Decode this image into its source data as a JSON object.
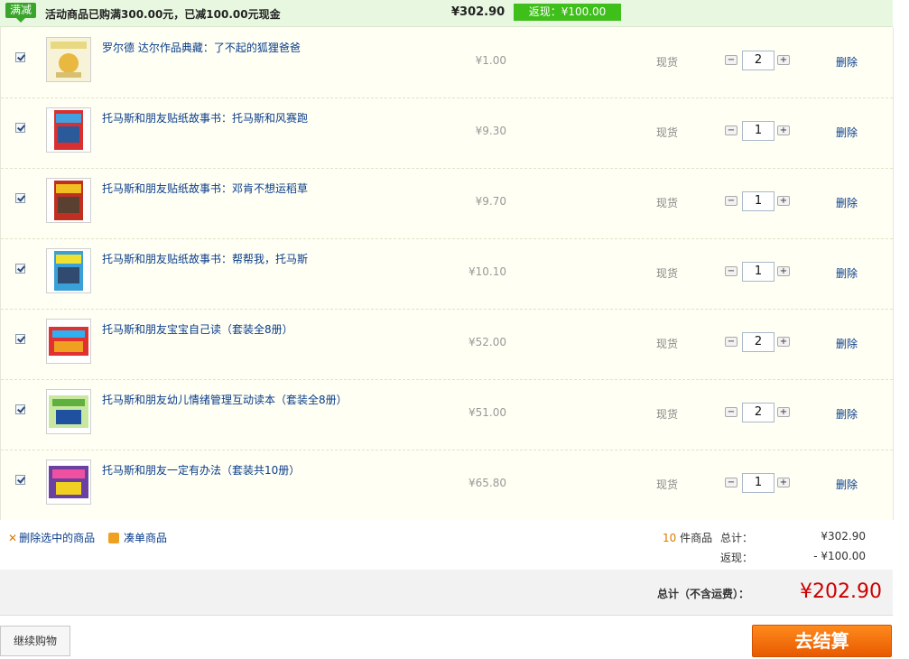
{
  "promo": {
    "tag": "满减",
    "text": "活动商品已购满300.00元，已减100.00元现金",
    "total": "¥302.90",
    "cashback": "返现：¥100.00"
  },
  "items": [
    {
      "title": "罗尔德 达尔作品典藏：了不起的狐狸爸爸",
      "price": "¥1.00",
      "stock": "现货",
      "qty": "2",
      "delete": "删除"
    },
    {
      "title": "托马斯和朋友贴纸故事书：托马斯和风赛跑",
      "price": "¥9.30",
      "stock": "现货",
      "qty": "1",
      "delete": "删除"
    },
    {
      "title": "托马斯和朋友贴纸故事书：邓肯不想运稻草",
      "price": "¥9.70",
      "stock": "现货",
      "qty": "1",
      "delete": "删除"
    },
    {
      "title": "托马斯和朋友贴纸故事书：帮帮我，托马斯",
      "price": "¥10.10",
      "stock": "现货",
      "qty": "1",
      "delete": "删除"
    },
    {
      "title": "托马斯和朋友宝宝自己读（套装全8册）",
      "price": "¥52.00",
      "stock": "现货",
      "qty": "2",
      "delete": "删除"
    },
    {
      "title": "托马斯和朋友幼儿情绪管理互动读本（套装全8册）",
      "price": "¥51.00",
      "stock": "现货",
      "qty": "2",
      "delete": "删除"
    },
    {
      "title": "托马斯和朋友一定有办法（套装共10册）",
      "price": "¥65.80",
      "stock": "现货",
      "qty": "1",
      "delete": "删除"
    }
  ],
  "footer": {
    "delete_selected": "删除选中的商品",
    "add_on": "凑单商品",
    "count": "10",
    "count_suffix": "件商品",
    "subtotal_label": "总计：",
    "subtotal_value": "¥302.90",
    "cashback_label": "返现：",
    "cashback_value": "- ¥100.00",
    "grand_label": "总计（不含运费）：",
    "grand_value": "¥202.90",
    "continue_shopping": "继续购物",
    "checkout": "去结算"
  },
  "colors": {
    "accent_orange": "#ff7a10",
    "price_red": "#cc0000",
    "link_blue": "#0a3d8a",
    "promo_green": "#3fbf1a"
  }
}
